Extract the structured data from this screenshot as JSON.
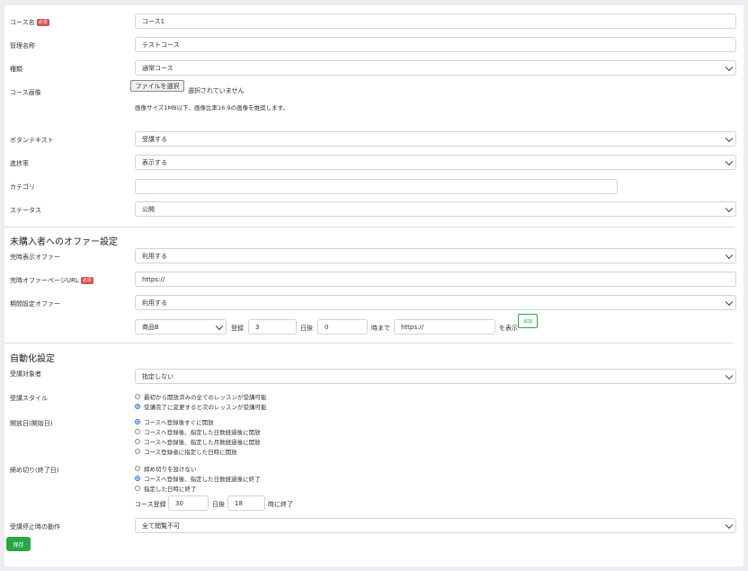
{
  "fields": {
    "course_name": {
      "label": "コース名",
      "required": "必須",
      "value": "コース1"
    },
    "admin_name": {
      "label": "管理名称",
      "value": "テストコース"
    },
    "type": {
      "label": "種類",
      "value": "通常コース"
    },
    "course_image": {
      "label": "コース画像",
      "file_button": "ファイルを選択",
      "file_status": "選択されていません",
      "hint": "画像サイズ1MB以下、画像比率16:9の画像を推奨します。"
    },
    "button_text": {
      "label": "ボタンテキスト",
      "value": "受講する"
    },
    "progress": {
      "label": "進捗率",
      "value": "表示する"
    },
    "category": {
      "label": "カテゴリ",
      "value": ""
    },
    "status": {
      "label": "ステータス",
      "value": "公開"
    }
  },
  "offer": {
    "title": "未購入者へのオファー設定",
    "instant_offer": {
      "label": "完時表示オファー",
      "value": "利用する"
    },
    "instant_url": {
      "label": "完時オファーページURL",
      "required": "必須",
      "value": "https://"
    },
    "timed_offer": {
      "label": "期間設定オファー",
      "value": "利用する"
    },
    "row": {
      "product": "商品B",
      "text_register": "登録",
      "days": "3",
      "text_days_after": "日後",
      "hours": "0",
      "text_until": "時まで",
      "url": "https://",
      "text_show": "を表示",
      "add": "追加"
    }
  },
  "auto": {
    "title": "自動化設定",
    "target": {
      "label": "受講対象者",
      "value": "指定しない"
    },
    "style": {
      "label": "受講スタイル",
      "options": [
        "最初から開放済みの全てのレッスンが受講可能",
        "受講完了に変更すると次のレッスンが受講可能"
      ],
      "selected": 1
    },
    "open_date": {
      "label": "開放日(開始日)",
      "options": [
        "コースへ登録後すぐに開放",
        "コースへ登録後、指定した日数経過後に開放",
        "コースへ登録後、指定した月数経過後に開放",
        "コース登録者に指定した日時に開放"
      ],
      "selected": 0
    },
    "deadline": {
      "label": "締め切り(終了日)",
      "options": [
        "締め切りを設けない",
        "コースへ登録後、指定した日数経過後に終了",
        "指定した日時に終了"
      ],
      "selected": 1
    },
    "deadline_row": {
      "text_register": "コース登録",
      "days": "30",
      "text_days_after": "日後",
      "hour": "18",
      "text_end": "時に終了"
    },
    "stop_action": {
      "label": "受講停止時の動作",
      "value": "全て閲覧不可"
    }
  },
  "save_label": "保存",
  "colors": {
    "required": "#dc4a4a",
    "save": "#28a745",
    "radio_on": "#0d6efd"
  }
}
